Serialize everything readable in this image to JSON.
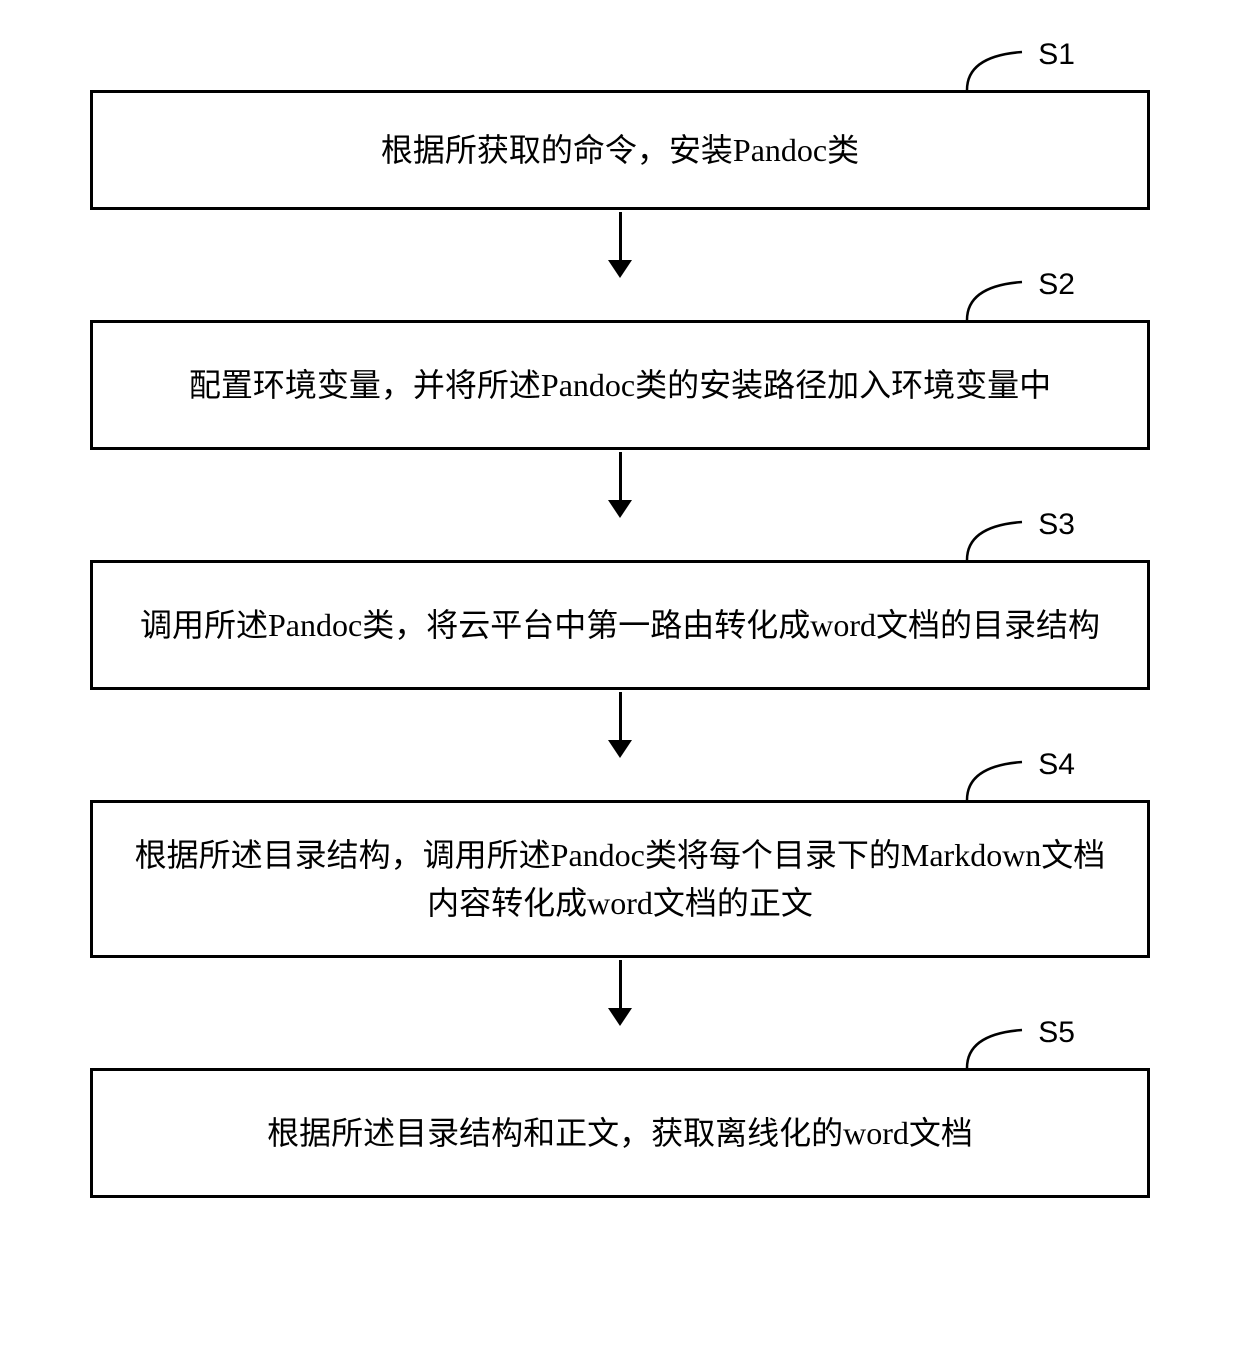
{
  "flowchart": {
    "steps": [
      {
        "id": "S1",
        "text": "根据所获取的命令，安装Pandoc类"
      },
      {
        "id": "S2",
        "text": "配置环境变量，并将所述Pandoc类的安装路径加入环境变量中"
      },
      {
        "id": "S3",
        "text": "调用所述Pandoc类，将云平台中第一路由转化成word文档的目录结构"
      },
      {
        "id": "S4",
        "text": "根据所述目录结构，调用所述Pandoc类将每个目录下的Markdown文档内容转化成word文档的正文"
      },
      {
        "id": "S5",
        "text": "根据所述目录结构和正文，获取离线化的word文档"
      }
    ]
  }
}
